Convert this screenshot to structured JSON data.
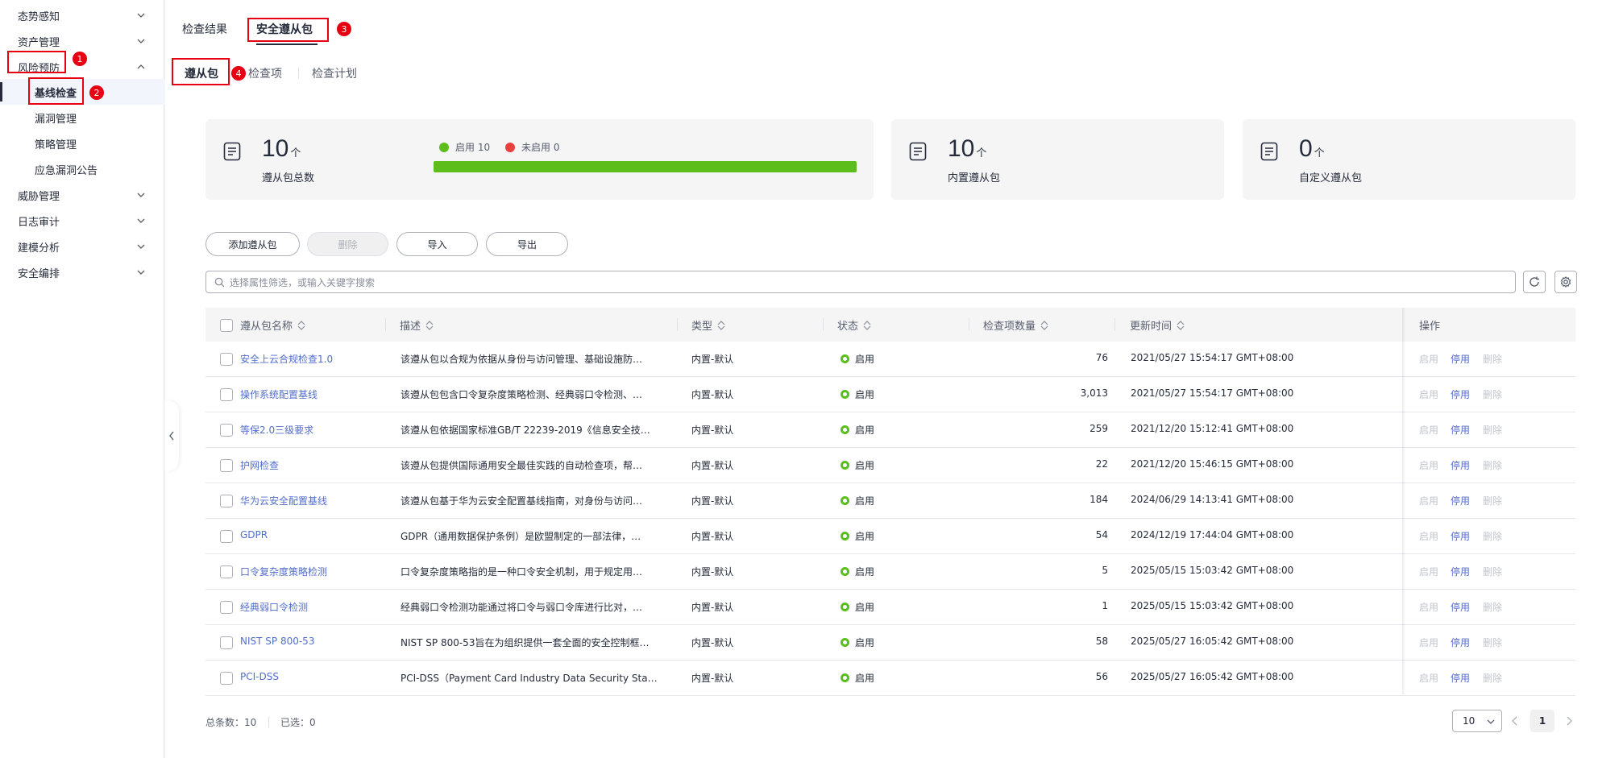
{
  "sidebar": {
    "items": [
      {
        "label": "态势感知"
      },
      {
        "label": "资产管理"
      },
      {
        "label": "风险预防"
      },
      {
        "label": "基线检查"
      },
      {
        "label": "漏洞管理"
      },
      {
        "label": "策略管理"
      },
      {
        "label": "应急漏洞公告"
      },
      {
        "label": "威胁管理"
      },
      {
        "label": "日志审计"
      },
      {
        "label": "建模分析"
      },
      {
        "label": "安全编排"
      }
    ]
  },
  "annotations": [
    "1",
    "2",
    "3",
    "4"
  ],
  "top_tabs": [
    {
      "label": "检查结果"
    },
    {
      "label": "安全遵从包"
    }
  ],
  "sub_tabs": [
    {
      "label": "遵从包"
    },
    {
      "label": "检查项"
    },
    {
      "label": "检查计划"
    }
  ],
  "stats": {
    "total": {
      "value": "10",
      "unit": "个",
      "label": "遵从包总数"
    },
    "legend": {
      "enabled": "启用 10",
      "disabled": "未启用 0"
    },
    "enabled_fraction": 1.0,
    "builtin": {
      "value": "10",
      "unit": "个",
      "label": "内置遵从包"
    },
    "custom": {
      "value": "0",
      "unit": "个",
      "label": "自定义遵从包"
    }
  },
  "toolbar": {
    "add": "添加遵从包",
    "delete": "删除",
    "import": "导入",
    "export": "导出"
  },
  "search": {
    "placeholder": "选择属性筛选，或输入关键字搜索"
  },
  "table": {
    "headers": {
      "name": "遵从包名称",
      "desc": "描述",
      "type": "类型",
      "status": "状态",
      "count": "检查项数量",
      "time": "更新时间",
      "ops": "操作"
    },
    "ops": {
      "enable": "启用",
      "disable": "停用",
      "delete": "删除"
    },
    "rows": [
      {
        "name": "安全上云合规检查1.0",
        "desc": "该遵从包以合规为依据从身份与访问管理、基础设施防…",
        "type": "内置-默认",
        "status": "启用",
        "count": "76",
        "time": "2021/05/27 15:54:17 GMT+08:00"
      },
      {
        "name": "操作系统配置基线",
        "desc": "该遵从包包含口令复杂度策略检测、经典弱口令检测、…",
        "type": "内置-默认",
        "status": "启用",
        "count": "3,013",
        "time": "2021/05/27 15:54:17 GMT+08:00"
      },
      {
        "name": "等保2.0三级要求",
        "desc": "该遵从包依据国家标准GB/T 22239-2019《信息安全技…",
        "type": "内置-默认",
        "status": "启用",
        "count": "259",
        "time": "2021/12/20 15:12:41 GMT+08:00"
      },
      {
        "name": "护网检查",
        "desc": "该遵从包提供国际通用安全最佳实践的自动检查项，帮…",
        "type": "内置-默认",
        "status": "启用",
        "count": "22",
        "time": "2021/12/20 15:46:15 GMT+08:00"
      },
      {
        "name": "华为云安全配置基线",
        "desc": "该遵从包基于华为云安全配置基线指南，对身份与访问…",
        "type": "内置-默认",
        "status": "启用",
        "count": "184",
        "time": "2024/06/29 14:13:41 GMT+08:00"
      },
      {
        "name": "GDPR",
        "desc": "GDPR（通用数据保护条例）是欧盟制定的一部法律，…",
        "type": "内置-默认",
        "status": "启用",
        "count": "54",
        "time": "2024/12/19 17:44:04 GMT+08:00"
      },
      {
        "name": "口令复杂度策略检测",
        "desc": "口令复杂度策略指的是一种口令安全机制，用于规定用…",
        "type": "内置-默认",
        "status": "启用",
        "count": "5",
        "time": "2025/05/15 15:03:42 GMT+08:00"
      },
      {
        "name": "经典弱口令检测",
        "desc": "经典弱口令检测功能通过将口令与弱口令库进行比对，…",
        "type": "内置-默认",
        "status": "启用",
        "count": "1",
        "time": "2025/05/15 15:03:42 GMT+08:00"
      },
      {
        "name": "NIST SP 800-53",
        "desc": "NIST SP 800-53旨在为组织提供一套全面的安全控制框…",
        "type": "内置-默认",
        "status": "启用",
        "count": "58",
        "time": "2025/05/27 16:05:42 GMT+08:00"
      },
      {
        "name": "PCI-DSS",
        "desc": "PCI-DSS（Payment Card Industry Data Security Stan…",
        "type": "内置-默认",
        "status": "启用",
        "count": "56",
        "time": "2025/05/27 16:05:42 GMT+08:00"
      }
    ]
  },
  "footer": {
    "total_label": "总条数：",
    "total": "10",
    "selected_label": "已选：",
    "selected": "0",
    "page_size": "10",
    "page": "1"
  },
  "colors": {
    "accent": "#526ecc",
    "success": "#5dbd1a",
    "danger": "#e9403c",
    "annotation": "#e60012"
  }
}
